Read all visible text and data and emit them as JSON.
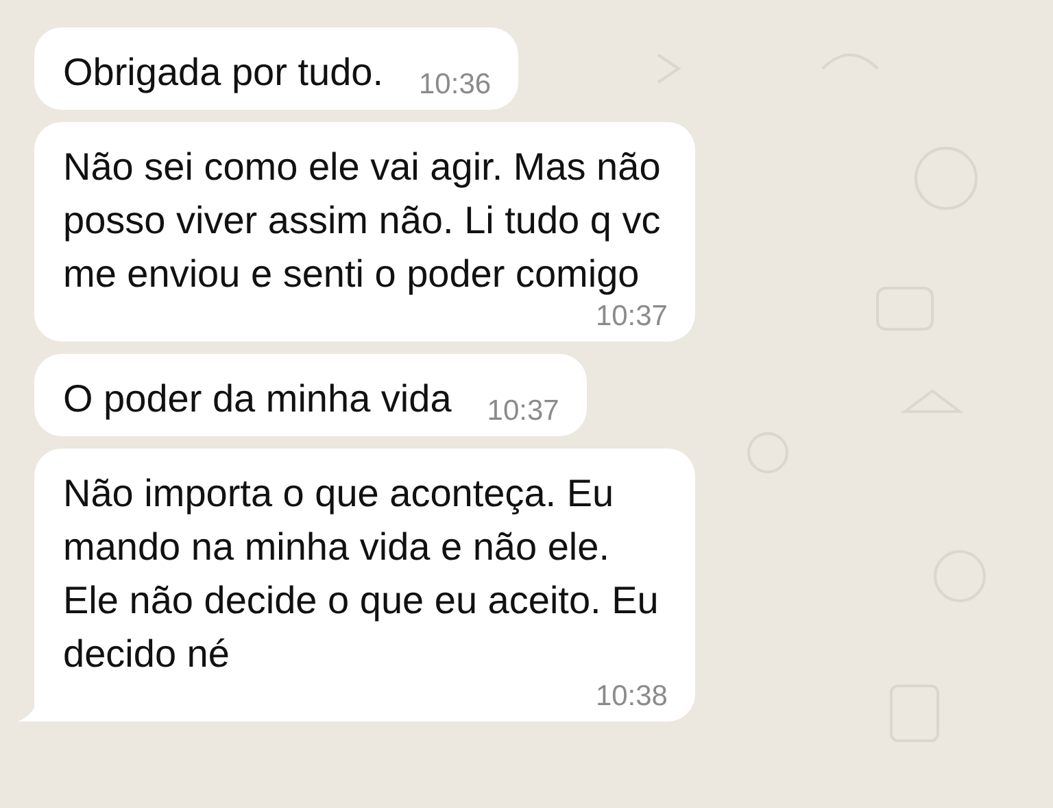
{
  "messages": [
    {
      "text": "Obrigada por tudo.",
      "time": "10:36",
      "tail": false
    },
    {
      "text": "Não sei como ele vai agir. Mas não posso viver assim não. Li tudo q vc me enviou e senti o poder comigo",
      "time": "10:37",
      "tail": false
    },
    {
      "text": "O poder da minha vida",
      "time": "10:37",
      "tail": false
    },
    {
      "text": "Não importa o que aconteça. Eu mando na minha vida e não ele. Ele não decide o que eu aceito. Eu decido né",
      "time": "10:38",
      "tail": true
    }
  ]
}
